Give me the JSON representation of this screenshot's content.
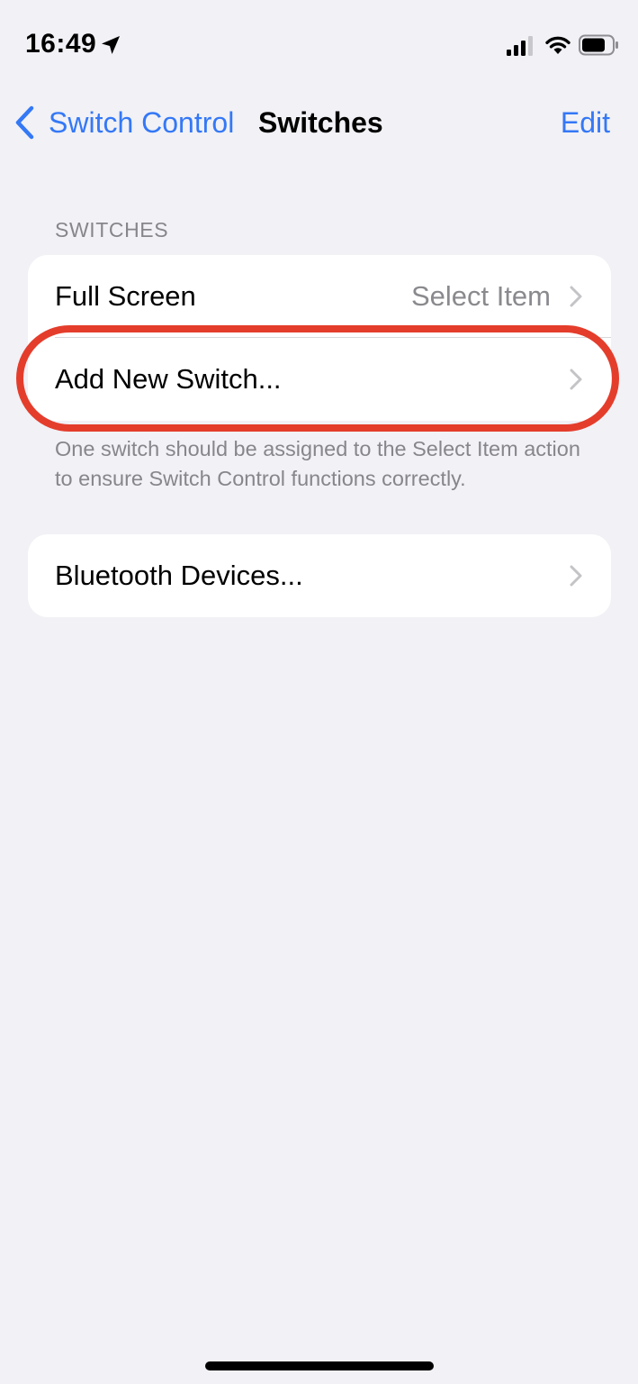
{
  "status_bar": {
    "time": "16:49",
    "icons": [
      "location-arrow-icon",
      "cellular-signal-icon",
      "wifi-icon",
      "battery-icon"
    ]
  },
  "nav": {
    "back_label": "Switch Control",
    "title": "Switches",
    "edit_label": "Edit"
  },
  "section": {
    "header": "SWITCHES",
    "rows": [
      {
        "label": "Full Screen",
        "value": "Select Item"
      },
      {
        "label": "Add New Switch..."
      }
    ],
    "footer": "One switch should be assigned to the Select Item action to ensure Switch Control functions correctly."
  },
  "bluetooth_group": {
    "rows": [
      {
        "label": "Bluetooth Devices..."
      }
    ]
  },
  "colors": {
    "accent": "#3478f6",
    "background": "#f1f1f6",
    "highlight": "#e43d2c",
    "secondary_text": "#86868b"
  }
}
